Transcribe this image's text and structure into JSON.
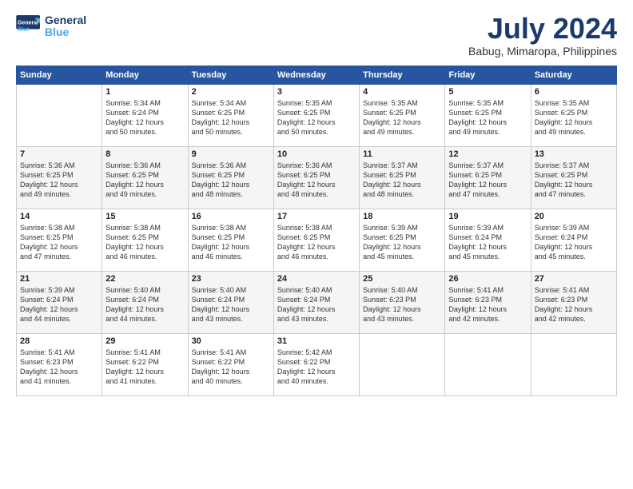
{
  "header": {
    "logo_line1": "General",
    "logo_line2": "Blue",
    "month": "July 2024",
    "location": "Babug, Mimaropa, Philippines"
  },
  "days_of_week": [
    "Sunday",
    "Monday",
    "Tuesday",
    "Wednesday",
    "Thursday",
    "Friday",
    "Saturday"
  ],
  "weeks": [
    [
      {
        "day": "",
        "info": ""
      },
      {
        "day": "1",
        "info": "Sunrise: 5:34 AM\nSunset: 6:24 PM\nDaylight: 12 hours\nand 50 minutes."
      },
      {
        "day": "2",
        "info": "Sunrise: 5:34 AM\nSunset: 6:25 PM\nDaylight: 12 hours\nand 50 minutes."
      },
      {
        "day": "3",
        "info": "Sunrise: 5:35 AM\nSunset: 6:25 PM\nDaylight: 12 hours\nand 50 minutes."
      },
      {
        "day": "4",
        "info": "Sunrise: 5:35 AM\nSunset: 6:25 PM\nDaylight: 12 hours\nand 49 minutes."
      },
      {
        "day": "5",
        "info": "Sunrise: 5:35 AM\nSunset: 6:25 PM\nDaylight: 12 hours\nand 49 minutes."
      },
      {
        "day": "6",
        "info": "Sunrise: 5:35 AM\nSunset: 6:25 PM\nDaylight: 12 hours\nand 49 minutes."
      }
    ],
    [
      {
        "day": "7",
        "info": ""
      },
      {
        "day": "8",
        "info": "Sunrise: 5:36 AM\nSunset: 6:25 PM\nDaylight: 12 hours\nand 49 minutes."
      },
      {
        "day": "9",
        "info": "Sunrise: 5:36 AM\nSunset: 6:25 PM\nDaylight: 12 hours\nand 48 minutes."
      },
      {
        "day": "10",
        "info": "Sunrise: 5:36 AM\nSunset: 6:25 PM\nDaylight: 12 hours\nand 48 minutes."
      },
      {
        "day": "11",
        "info": "Sunrise: 5:37 AM\nSunset: 6:25 PM\nDaylight: 12 hours\nand 48 minutes."
      },
      {
        "day": "12",
        "info": "Sunrise: 5:37 AM\nSunset: 6:25 PM\nDaylight: 12 hours\nand 47 minutes."
      },
      {
        "day": "13",
        "info": "Sunrise: 5:37 AM\nSunset: 6:25 PM\nDaylight: 12 hours\nand 47 minutes."
      }
    ],
    [
      {
        "day": "14",
        "info": ""
      },
      {
        "day": "15",
        "info": "Sunrise: 5:38 AM\nSunset: 6:25 PM\nDaylight: 12 hours\nand 46 minutes."
      },
      {
        "day": "16",
        "info": "Sunrise: 5:38 AM\nSunset: 6:25 PM\nDaylight: 12 hours\nand 46 minutes."
      },
      {
        "day": "17",
        "info": "Sunrise: 5:38 AM\nSunset: 6:25 PM\nDaylight: 12 hours\nand 46 minutes."
      },
      {
        "day": "18",
        "info": "Sunrise: 5:39 AM\nSunset: 6:25 PM\nDaylight: 12 hours\nand 45 minutes."
      },
      {
        "day": "19",
        "info": "Sunrise: 5:39 AM\nSunset: 6:24 PM\nDaylight: 12 hours\nand 45 minutes."
      },
      {
        "day": "20",
        "info": "Sunrise: 5:39 AM\nSunset: 6:24 PM\nDaylight: 12 hours\nand 45 minutes."
      }
    ],
    [
      {
        "day": "21",
        "info": ""
      },
      {
        "day": "22",
        "info": "Sunrise: 5:40 AM\nSunset: 6:24 PM\nDaylight: 12 hours\nand 44 minutes."
      },
      {
        "day": "23",
        "info": "Sunrise: 5:40 AM\nSunset: 6:24 PM\nDaylight: 12 hours\nand 43 minutes."
      },
      {
        "day": "24",
        "info": "Sunrise: 5:40 AM\nSunset: 6:24 PM\nDaylight: 12 hours\nand 43 minutes."
      },
      {
        "day": "25",
        "info": "Sunrise: 5:40 AM\nSunset: 6:23 PM\nDaylight: 12 hours\nand 43 minutes."
      },
      {
        "day": "26",
        "info": "Sunrise: 5:41 AM\nSunset: 6:23 PM\nDaylight: 12 hours\nand 42 minutes."
      },
      {
        "day": "27",
        "info": "Sunrise: 5:41 AM\nSunset: 6:23 PM\nDaylight: 12 hours\nand 42 minutes."
      }
    ],
    [
      {
        "day": "28",
        "info": "Sunrise: 5:41 AM\nSunset: 6:23 PM\nDaylight: 12 hours\nand 41 minutes."
      },
      {
        "day": "29",
        "info": "Sunrise: 5:41 AM\nSunset: 6:22 PM\nDaylight: 12 hours\nand 41 minutes."
      },
      {
        "day": "30",
        "info": "Sunrise: 5:41 AM\nSunset: 6:22 PM\nDaylight: 12 hours\nand 40 minutes."
      },
      {
        "day": "31",
        "info": "Sunrise: 5:42 AM\nSunset: 6:22 PM\nDaylight: 12 hours\nand 40 minutes."
      },
      {
        "day": "",
        "info": ""
      },
      {
        "day": "",
        "info": ""
      },
      {
        "day": "",
        "info": ""
      }
    ]
  ],
  "week1_sun_info": "Sunrise: 5:36 AM\nSunset: 6:25 PM\nDaylight: 12 hours\nand 49 minutes.",
  "week3_sun_info": "Sunrise: 5:38 AM\nSunset: 6:25 PM\nDaylight: 12 hours\nand 47 minutes.",
  "week4_sun_info": "Sunrise: 5:39 AM\nSunset: 6:24 PM\nDaylight: 12 hours\nand 44 minutes."
}
